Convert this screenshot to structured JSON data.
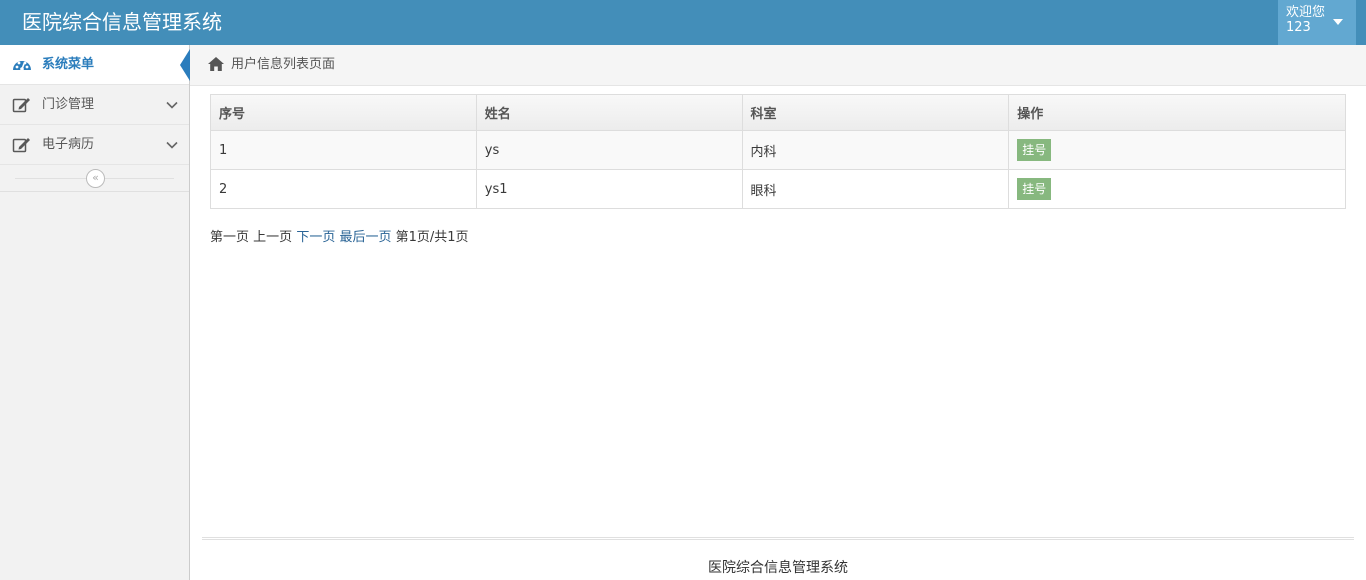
{
  "app": {
    "title": "医院综合信息管理系统"
  },
  "user": {
    "welcome": "欢迎您",
    "name": "123"
  },
  "sidebar": {
    "items": [
      {
        "label": "系统菜单",
        "icon": "dashboard-icon",
        "active": true
      },
      {
        "label": "门诊管理",
        "icon": "edit-icon",
        "active": false
      },
      {
        "label": "电子病历",
        "icon": "edit-icon",
        "active": false
      }
    ],
    "collapse_glyph": "«"
  },
  "breadcrumb": {
    "text": "用户信息列表页面",
    "icon": "home-icon"
  },
  "table": {
    "headers": [
      "序号",
      "姓名",
      "科室",
      "操作"
    ],
    "rows": [
      {
        "id": "1",
        "name": "ys",
        "dept": "内科",
        "action": "挂号"
      },
      {
        "id": "2",
        "name": "ys1",
        "dept": "眼科",
        "action": "挂号"
      }
    ]
  },
  "pager": {
    "first": "第一页",
    "prev": "上一页",
    "next": "下一页",
    "last": "最后一页",
    "status": "第1页/共1页"
  },
  "footer": {
    "text": "医院综合信息管理系统"
  },
  "colors": {
    "navbar": "#438eb9",
    "user_box": "#62a8d1",
    "sidebar_active": "#2b7dbc",
    "button_success": "#87b87f",
    "link": "#2a6496"
  }
}
